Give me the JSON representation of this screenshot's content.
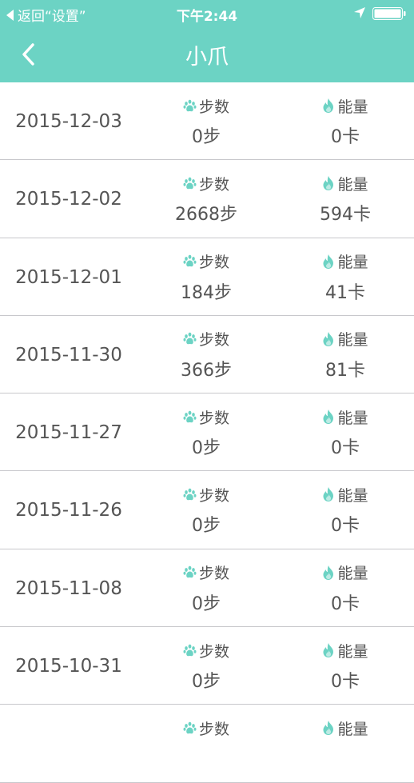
{
  "status_bar": {
    "back_label": "返回“设置”",
    "time": "下午2:44"
  },
  "nav": {
    "title": "小爪"
  },
  "colors": {
    "accent": "#6cd3c4"
  },
  "labels": {
    "steps": "步数",
    "energy": "能量"
  },
  "records": [
    {
      "date": "2015-12-03",
      "steps": "0步",
      "energy": "0卡"
    },
    {
      "date": "2015-12-02",
      "steps": "2668步",
      "energy": "594卡"
    },
    {
      "date": "2015-12-01",
      "steps": "184步",
      "energy": "41卡"
    },
    {
      "date": "2015-11-30",
      "steps": "366步",
      "energy": "81卡"
    },
    {
      "date": "2015-11-27",
      "steps": "0步",
      "energy": "0卡"
    },
    {
      "date": "2015-11-26",
      "steps": "0步",
      "energy": "0卡"
    },
    {
      "date": "2015-11-08",
      "steps": "0步",
      "energy": "0卡"
    },
    {
      "date": "2015-10-31",
      "steps": "0步",
      "energy": "0卡"
    },
    {
      "date": "",
      "steps": "",
      "energy": ""
    }
  ]
}
